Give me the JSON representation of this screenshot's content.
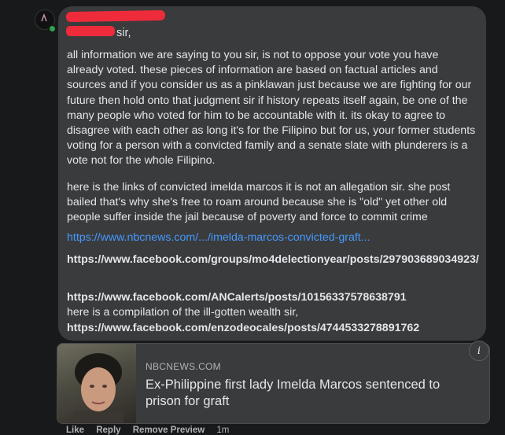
{
  "comment": {
    "greeting": "sir,",
    "paragraph1": "all information we are saying to you sir, is not to oppose your vote you have already voted. these pieces of information are based on factual articles and sources and if you consider us as a pinklawan just because we are fighting for our future then hold onto that judgment sir if history repeats itself again, be one of the many people who voted for him to be accountable with it. its okay to agree to disagree with each other as long it's for the Filipino but for us, your former students voting for a person with a convicted family and a senate slate with plunderers is a vote not for the whole Filipino.",
    "paragraph2": "here is the links of convicted imelda marcos it is not an allegation sir. she post bailed that's why she's free to roam around because she is \"old\" yet other old people suffer inside the jail because of poverty and force to commit crime",
    "link1": "https://www.nbcnews.com/.../imelda-marcos-convicted-graft...",
    "link2": "https://www.facebook.com/groups/mo4delectionyear/posts/297903689034923/",
    "link3": "https://www.facebook.com/ANCalerts/posts/10156337578638791",
    "line_compilation": "here is a compilation of the ill-gotten wealth sir,",
    "link4": "https://www.facebook.com/enzodeocales/posts/4744533278891762"
  },
  "preview": {
    "source": "NBCNEWS.COM",
    "headline": "Ex-Philippine first lady Imelda Marcos sentenced to prison for graft"
  },
  "info_button": "i",
  "actions": {
    "like": "Like",
    "reply": "Reply",
    "remove_preview": "Remove Preview",
    "time": "1m"
  },
  "colors": {
    "background": "#18191a",
    "bubble": "#3a3b3c",
    "link": "#4599ff",
    "redaction": "#ee2b3a",
    "online": "#31a24c"
  },
  "icons": [
    "avatar",
    "online-status-dot",
    "info-icon"
  ]
}
